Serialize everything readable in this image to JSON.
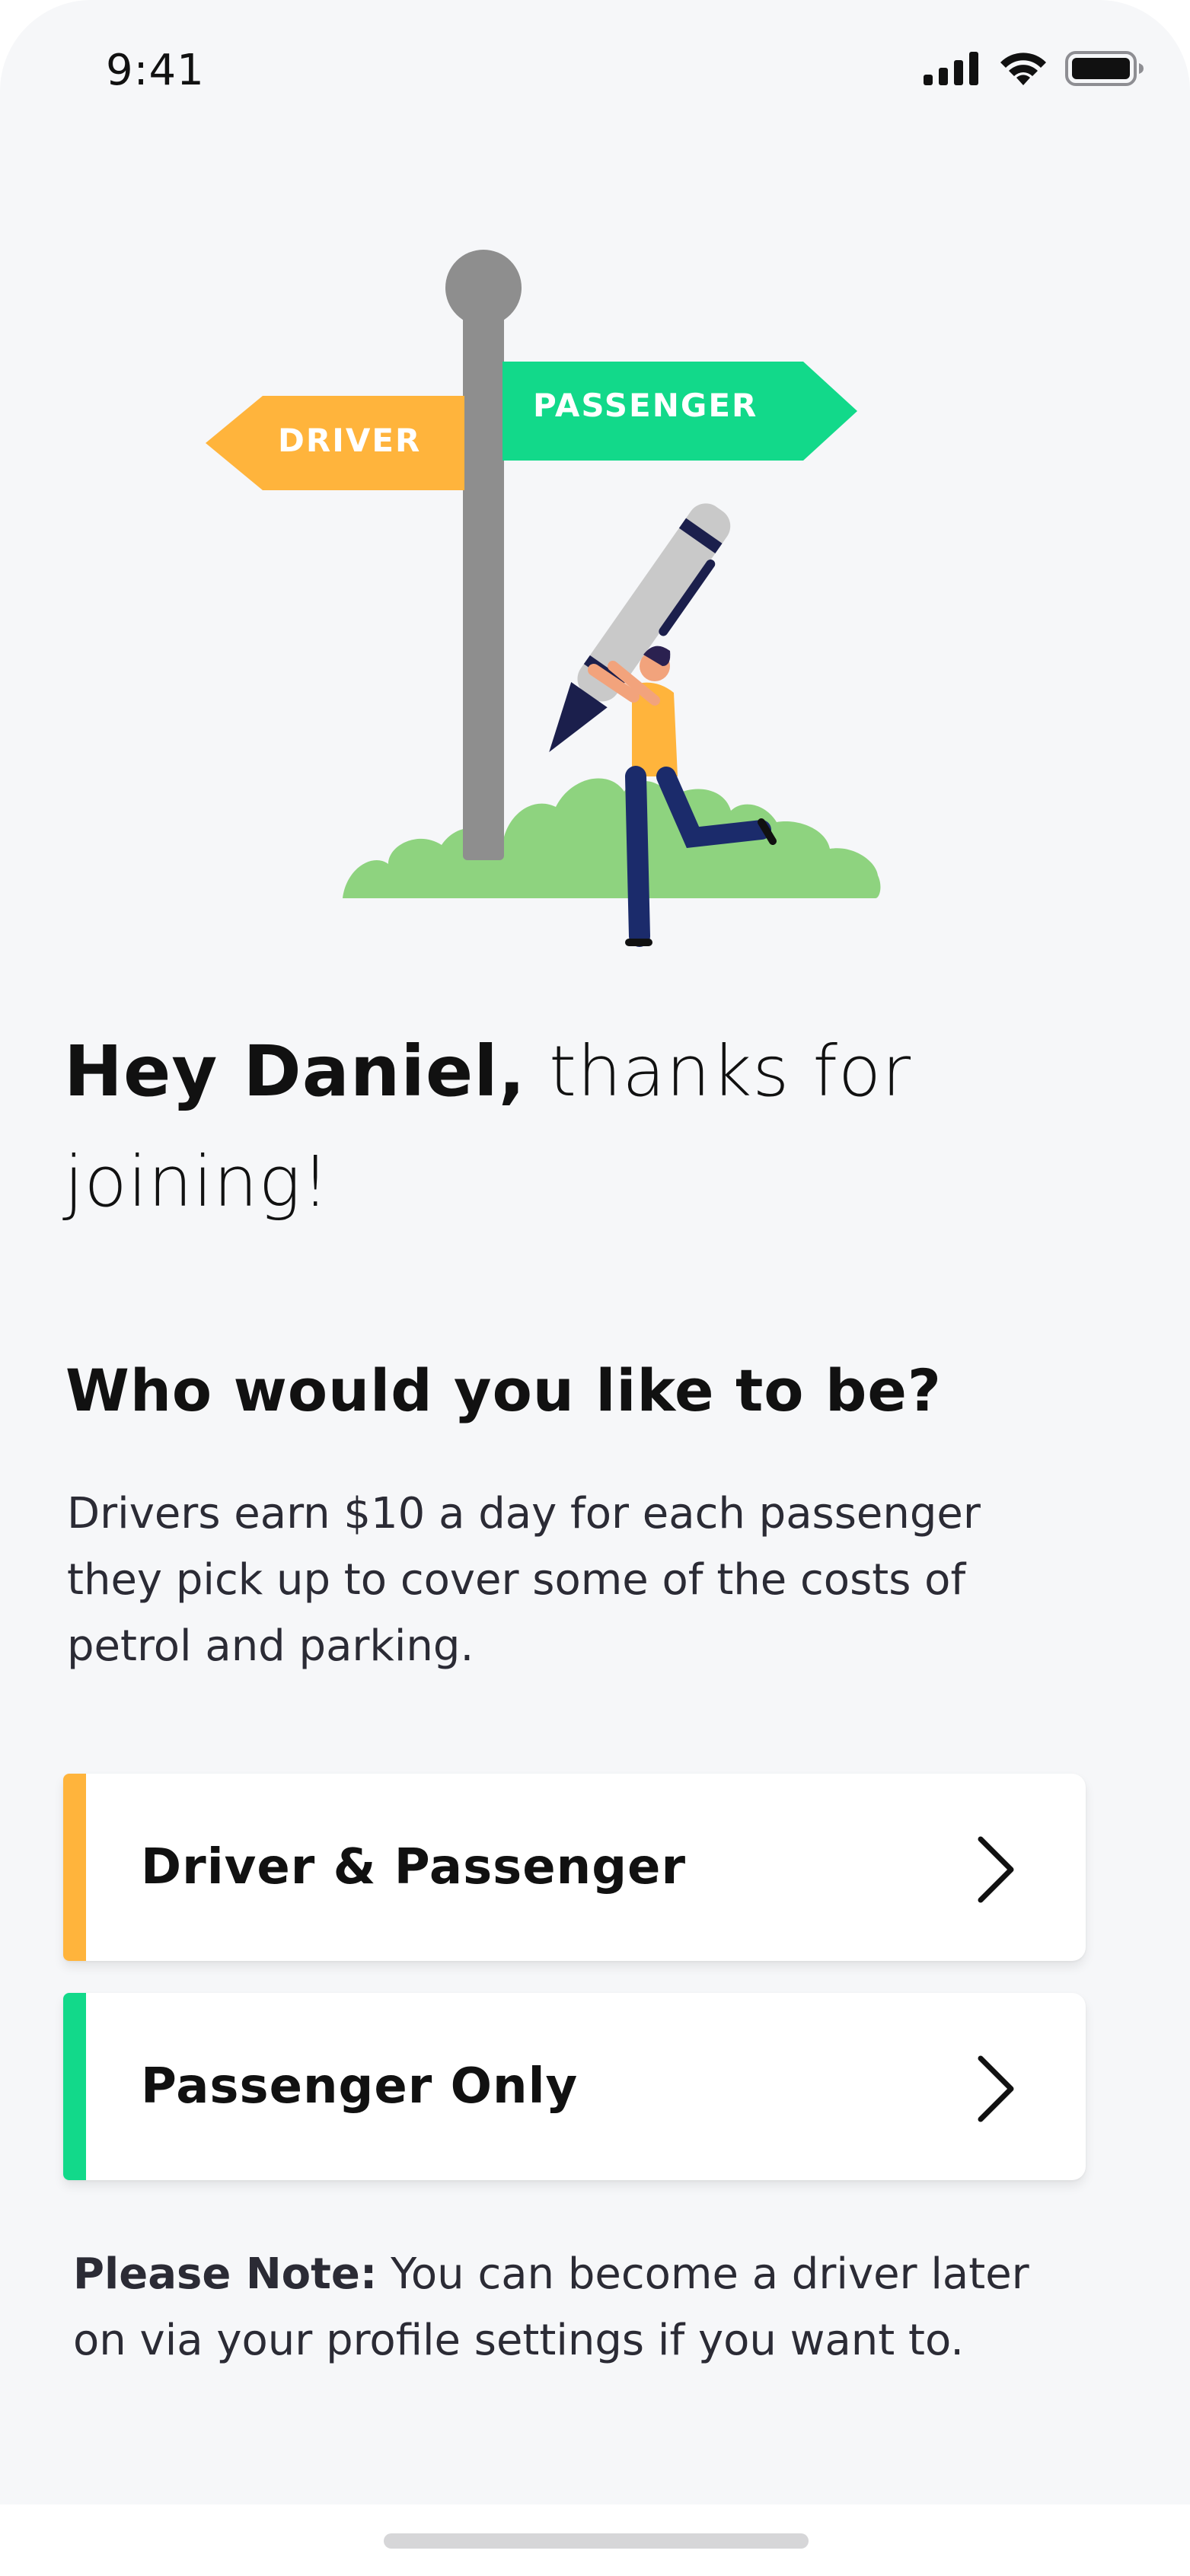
{
  "status_bar": {
    "time": "9:41"
  },
  "illustration": {
    "driver_sign": "DRIVER",
    "passenger_sign": "PASSENGER",
    "colors": {
      "driver": "#FFB43C",
      "passenger": "#12D98A",
      "pole": "#8E8E8E",
      "bush": "#8ED37F"
    }
  },
  "greeting": {
    "bold": "Hey Daniel,",
    "rest": " thanks for joining!"
  },
  "question": "Who would you like to be?",
  "description": "Drivers earn $10 a day for each passenger they pick up to cover some of the costs of petrol and parking.",
  "options": [
    {
      "label": "Driver & Passenger",
      "accent": "#FFB43C",
      "icon": "chevron-right-icon"
    },
    {
      "label": "Passenger Only",
      "accent": "#12D98A",
      "icon": "chevron-right-icon"
    }
  ],
  "note": {
    "bold": "Please Note:",
    "text": " You can become a driver later on via your profile settings if you want to."
  }
}
